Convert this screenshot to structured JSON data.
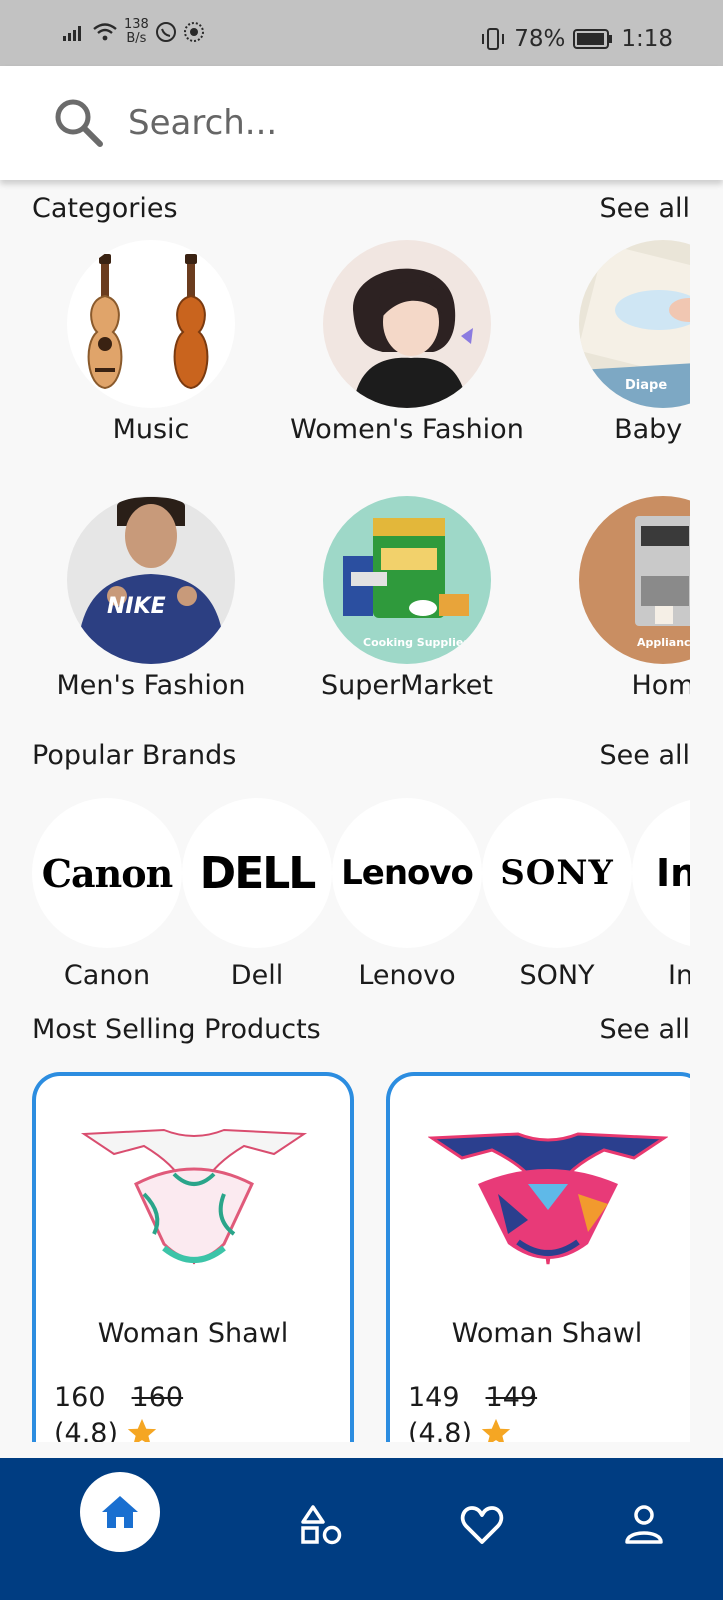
{
  "status_bar": {
    "network_speed_value": "138",
    "network_speed_unit": "B/s",
    "battery": "78%",
    "time": "1:18"
  },
  "search": {
    "placeholder": "Search..."
  },
  "categories": {
    "title": "Categories",
    "see_all": "See all",
    "items": [
      {
        "label": "Music",
        "image_text": ""
      },
      {
        "label": "Women's Fashion",
        "image_text": ""
      },
      {
        "label": "Baby & ",
        "image_text": "Diape"
      },
      {
        "label": "Men's Fashion",
        "image_text": "NIKE"
      },
      {
        "label": "SuperMarket",
        "image_text": "Cooking Supplies"
      },
      {
        "label": "Hom",
        "image_text": "Appliance"
      }
    ]
  },
  "brands": {
    "title": "Popular Brands",
    "see_all": "See all",
    "items": [
      {
        "label": "Canon",
        "logo": "Canon"
      },
      {
        "label": "Dell",
        "logo": "DELL"
      },
      {
        "label": "Lenovo",
        "logo": "Lenovo"
      },
      {
        "label": "SONY",
        "logo": "SONY"
      },
      {
        "label": "In",
        "logo": "Inf"
      }
    ]
  },
  "products": {
    "title": "Most Selling Products",
    "see_all": "See all",
    "items": [
      {
        "name": "Woman Shawl",
        "price": "160",
        "old_price": "160",
        "rating": "(4.8)"
      },
      {
        "name": "Woman Shawl",
        "price": "149",
        "old_price": "149",
        "rating": "(4.8)"
      }
    ]
  },
  "colors": {
    "nav_background": "#003d82",
    "accent": "#2c8de0",
    "star": "#f5a623"
  },
  "bottom_nav": {
    "items": [
      "home-icon",
      "categories-icon",
      "heart-icon",
      "profile-icon"
    ],
    "active": "home-icon"
  }
}
